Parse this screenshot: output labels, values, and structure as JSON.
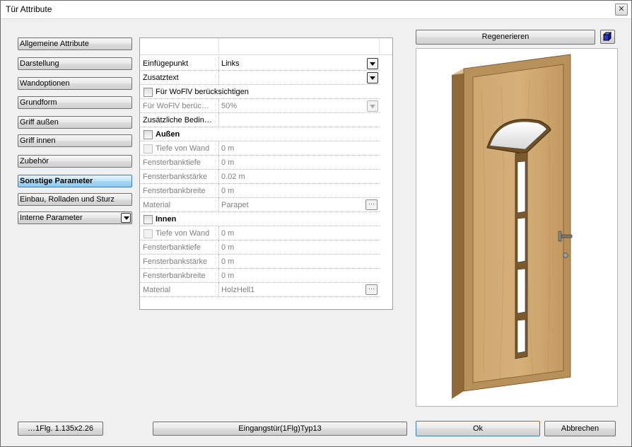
{
  "window": {
    "title": "Tür Attribute",
    "close_label": "✕"
  },
  "sidebar": {
    "items": [
      {
        "label": "Allgemeine Attribute"
      },
      {
        "label": "Darstellung"
      },
      {
        "label": "Wandoptionen"
      },
      {
        "label": "Grundform"
      },
      {
        "label": "Griff außen"
      },
      {
        "label": "Griff innen"
      },
      {
        "label": "Zubehör"
      },
      {
        "label": "Sonstige Parameter",
        "active": true
      },
      {
        "label": "Einbau, Rolladen und Sturz"
      }
    ],
    "dropdown_label": "Interne Parameter"
  },
  "props": {
    "einfuegepunkt": {
      "label": "Einfügepunkt",
      "value": "Links"
    },
    "zusatztext": {
      "label": "Zusatztext",
      "value": ""
    },
    "wofiv_check": {
      "label": "Für WoFlV berücksichtigen"
    },
    "wofiv": {
      "label": "Für WoFlV berüc…",
      "value": "50%"
    },
    "zusatz_bed": {
      "label": "Zusätzliche Bedin…"
    },
    "aussen": {
      "header": "Außen",
      "tiefe": {
        "label": "Tiefe von Wand",
        "value": "0 m"
      },
      "fbtiefe": {
        "label": "Fensterbanktiefe",
        "value": "0 m"
      },
      "fbstaerke": {
        "label": "Fensterbankstärke",
        "value": "0.02 m"
      },
      "fbbreite": {
        "label": "Fensterbankbreite",
        "value": "0 m"
      },
      "material": {
        "label": "Material",
        "value": "Parapet"
      }
    },
    "innen": {
      "header": "Innen",
      "tiefe": {
        "label": "Tiefe von Wand",
        "value": "0 m"
      },
      "fbtiefe": {
        "label": "Fensterbanktiefe",
        "value": "0 m"
      },
      "fbstaerke": {
        "label": "Fensterbankstärke",
        "value": "0 m"
      },
      "fbbreite": {
        "label": "Fensterbankbreite",
        "value": "0 m"
      },
      "material": {
        "label": "Material",
        "value": "HolzHell1"
      }
    },
    "ellipsis": "···"
  },
  "preview": {
    "regenerate_label": "Regenerieren"
  },
  "footer": {
    "size_label": "…1Flg. 1.135x2.26",
    "type_label": "Eingangstür(1Flg)Typ13",
    "ok_label": "Ok",
    "cancel_label": "Abbrechen"
  },
  "colors": {
    "door_wood": "#c9a46a",
    "door_frame": "#b8915a",
    "active_tab": "#a7d9f5"
  }
}
